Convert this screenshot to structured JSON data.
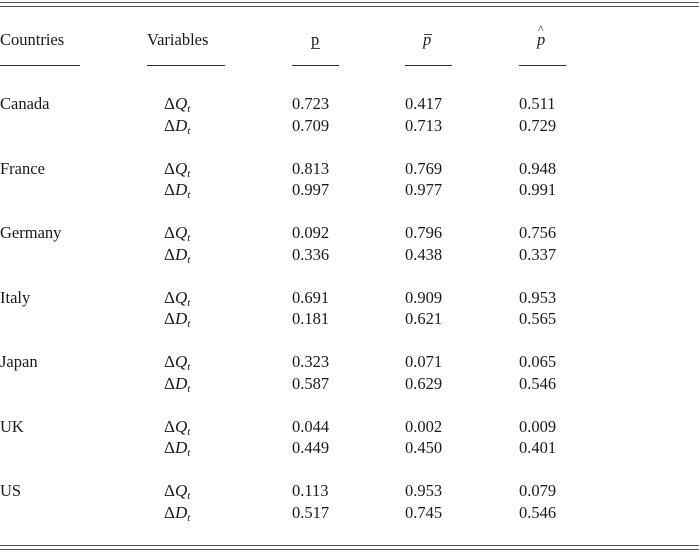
{
  "table": {
    "headers": {
      "countries": "Countries",
      "variables": "Variables",
      "p_lower": "p",
      "p_bar": "p",
      "p_hat": "p"
    },
    "header_symbols": {
      "p_lower": "underbar",
      "p_bar": "bar",
      "p_hat": "hat"
    },
    "variable_labels": {
      "dQ": {
        "delta": "Δ",
        "letter": "Q",
        "sub": "t"
      },
      "dD": {
        "delta": "Δ",
        "letter": "D",
        "sub": "t"
      }
    },
    "rows": [
      {
        "country": "Canada",
        "dQ": [
          "0.723",
          "0.417",
          "0.511"
        ],
        "dD": [
          "0.709",
          "0.713",
          "0.729"
        ]
      },
      {
        "country": "France",
        "dQ": [
          "0.813",
          "0.769",
          "0.948"
        ],
        "dD": [
          "0.997",
          "0.977",
          "0.991"
        ]
      },
      {
        "country": "Germany",
        "dQ": [
          "0.092",
          "0.796",
          "0.756"
        ],
        "dD": [
          "0.336",
          "0.438",
          "0.337"
        ]
      },
      {
        "country": "Italy",
        "dQ": [
          "0.691",
          "0.909",
          "0.953"
        ],
        "dD": [
          "0.181",
          "0.621",
          "0.565"
        ]
      },
      {
        "country": "Japan",
        "dQ": [
          "0.323",
          "0.071",
          "0.065"
        ],
        "dD": [
          "0.587",
          "0.629",
          "0.546"
        ]
      },
      {
        "country": "UK",
        "dQ": [
          "0.044",
          "0.002",
          "0.009"
        ],
        "dD": [
          "0.449",
          "0.450",
          "0.401"
        ]
      },
      {
        "country": "US",
        "dQ": [
          "0.113",
          "0.953",
          "0.079"
        ],
        "dD": [
          "0.517",
          "0.745",
          "0.546"
        ]
      }
    ]
  }
}
